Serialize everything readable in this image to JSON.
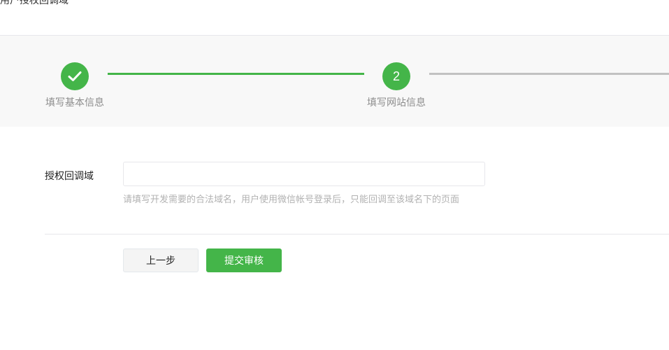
{
  "header": {
    "title": "用户授权回调域"
  },
  "steps": [
    {
      "label": "填写基本信息",
      "status": "done",
      "icon": "check-icon"
    },
    {
      "label": "填写网站信息",
      "number": "2",
      "status": "active"
    }
  ],
  "form": {
    "field_label": "授权回调域",
    "field_value": "",
    "tip": "请填写开发需要的合法域名，用户使用微信帐号登录后，只能回调至该域名下的页面"
  },
  "buttons": {
    "prev_label": "上一步",
    "submit_label": "提交审核"
  },
  "colors": {
    "accent": "#44b549",
    "inactive_line": "#c2c2c2",
    "steps_bg": "#f8f8f8"
  }
}
